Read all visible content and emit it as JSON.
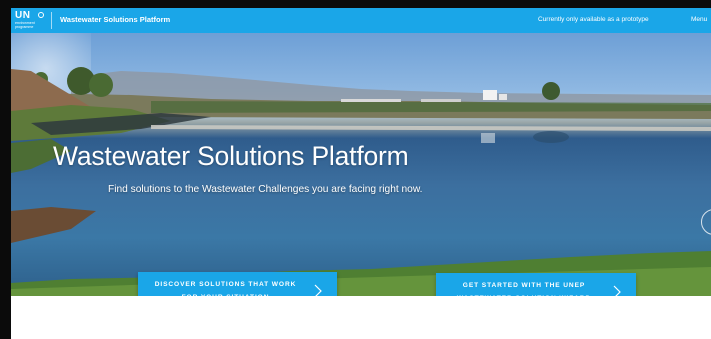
{
  "header": {
    "logo_top": "UN",
    "logo_sub": "environment programme",
    "title": "Wastewater Solutions Platform",
    "prototype_note": "Currently only available as a prototype",
    "menu_label": "Menu"
  },
  "hero": {
    "title": "Wastewater Solutions Platform",
    "subtitle": "Find solutions to the Wastewater Challenges you are facing right now."
  },
  "cta": {
    "discover_line1": "Discover solutions that work",
    "discover_line2": "for your situation",
    "wizard_line1": "Get started with the UNEP",
    "wizard_line2": "Wastewater Solution Wizard"
  },
  "colors": {
    "accent": "#1aa6e8",
    "frame": "#0b0b0b"
  },
  "icons": {
    "logo": "un-environment-logo",
    "next": "chevron-right-icon",
    "carousel": "carousel-next-icon"
  }
}
